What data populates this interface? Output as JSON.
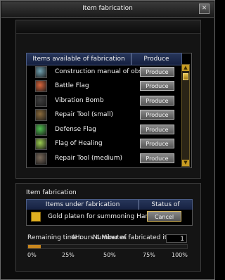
{
  "window": {
    "title": "Item fabrication",
    "close_glyph": "✕"
  },
  "list": {
    "col_items": "Items available of fabrication",
    "col_produce": "Produce",
    "items": [
      {
        "name": "Construction manual of obstacles",
        "button": "Produce",
        "icon": "manual-icon",
        "color": "#6fa0b0"
      },
      {
        "name": "Battle Flag",
        "button": "Produce",
        "icon": "battle-flag-icon",
        "color": "#d9643a"
      },
      {
        "name": "Vibration Bomb",
        "button": "Produce",
        "icon": "bomb-icon",
        "color": "#3e3e3e"
      },
      {
        "name": "Repair Tool (small)",
        "button": "Produce",
        "icon": "pickaxe-icon",
        "color": "#8a6a3a"
      },
      {
        "name": "Defense Flag",
        "button": "Produce",
        "icon": "defense-flag-icon",
        "color": "#4fbf4f"
      },
      {
        "name": "Flag of Healing",
        "button": "Produce",
        "icon": "healing-flag-icon",
        "color": "#9acd50"
      },
      {
        "name": "Repair Tool (medium)",
        "button": "Produce",
        "icon": "pickaxe-icon",
        "color": "#7a6a5a"
      }
    ],
    "scroll_up": "▲",
    "scroll_down": "▼"
  },
  "fabrication": {
    "section_label": "Item fabrication",
    "col_items": "Items under fabrication",
    "col_status": "Status of progress",
    "current_item": "Gold platen for summoning Hang-A",
    "current_icon": "gold-platen-icon",
    "current_icon_color": "#e0b020",
    "cancel_label": "Cancel",
    "remaining_label": "Remaining time :",
    "remaining_value": "4Hours 4 Minutes",
    "count_label": "Number of fabricated items",
    "count_value": "1",
    "progress_fraction": 0.08,
    "ticks": [
      "0%",
      "25%",
      "50%",
      "75%",
      "100%"
    ]
  }
}
